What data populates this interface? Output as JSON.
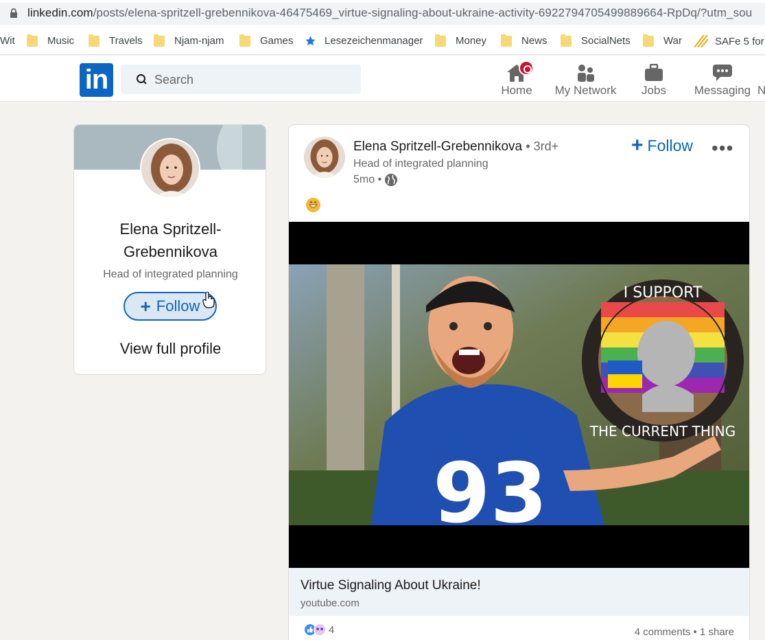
{
  "browser": {
    "url_host": "linkedin.com",
    "url_path": "/posts/elena-spritzell-grebennikova-46475469_virtue-signaling-about-ukraine-activity-6922794705499889664-RpDq/?utm_sou",
    "bookmarks": [
      {
        "label": "Wit",
        "icon": "folder-icon"
      },
      {
        "label": "Music",
        "icon": "folder-icon"
      },
      {
        "label": "Travels",
        "icon": "folder-icon"
      },
      {
        "label": "Njam-njam",
        "icon": "folder-icon"
      },
      {
        "label": "Games",
        "icon": "folder-icon"
      },
      {
        "label": "Lesezeichenmanager",
        "icon": "star-icon"
      },
      {
        "label": "Money",
        "icon": "folder-icon"
      },
      {
        "label": "News",
        "icon": "folder-icon"
      },
      {
        "label": "SocialNets",
        "icon": "folder-icon"
      },
      {
        "label": "War",
        "icon": "folder-icon"
      },
      {
        "label": "SAFe 5 for",
        "icon": "safe-icon"
      }
    ]
  },
  "nav": {
    "logo": "in",
    "search_placeholder": "Search",
    "items": [
      {
        "label": "Home",
        "icon": "home-icon"
      },
      {
        "label": "My Network",
        "icon": "network-icon"
      },
      {
        "label": "Jobs",
        "icon": "briefcase-icon"
      },
      {
        "label": "Messaging",
        "icon": "messaging-icon"
      },
      {
        "label": "N",
        "icon": ""
      }
    ]
  },
  "profile": {
    "name": "Elena Spritzell-Grebennikova",
    "headline": "Head of integrated planning",
    "follow_label": "Follow",
    "view_profile": "View full profile"
  },
  "post": {
    "author": "Elena Spritzell-Grebennikova",
    "degree": "• 3rd+",
    "headline": "Head of integrated planning",
    "time": "5mo •",
    "follow_label": "Follow",
    "more": "•••",
    "link_title": "Virtue Signaling About Ukraine!",
    "link_source": "youtube.com",
    "reaction_count": "4",
    "comments": "4 comments • 1 share",
    "thumb_badge_top": "I SUPPORT",
    "thumb_badge_bottom": "THE CURRENT THING",
    "thumb_jersey": "93"
  },
  "colors": {
    "linkedin_blue": "#0a66c2",
    "badge_red": "#cb112d",
    "page_bg": "#f3f2ef"
  }
}
